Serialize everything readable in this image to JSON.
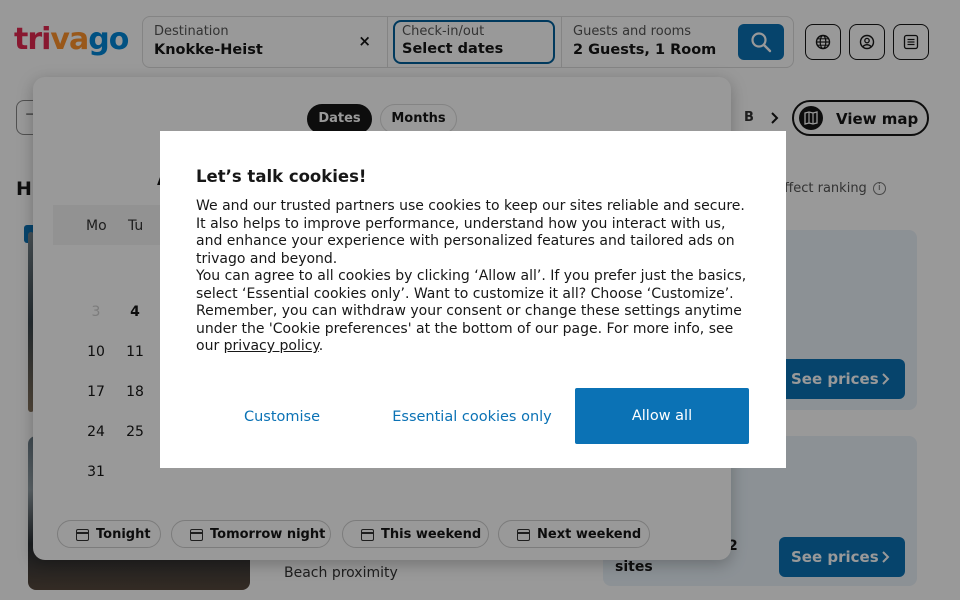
{
  "header": {
    "logo": {
      "part1": "tri",
      "part2": "va",
      "part3": "go"
    },
    "destination": {
      "label": "Destination",
      "value": "Knokke-Heist",
      "clear_icon": "×"
    },
    "dates": {
      "label": "Check-in/out",
      "value": "Select dates"
    },
    "guests": {
      "label": "Guests and rooms",
      "value": "2 Guests, 1 Room"
    },
    "icons": [
      "search-icon",
      "globe-icon",
      "user-icon",
      "menu-icon"
    ]
  },
  "results": {
    "heading_partial": "H",
    "ranking_note": "to us affect ranking",
    "info_icon": "i",
    "filter_partial": "B",
    "map_button": "View map",
    "see_prices": "See prices",
    "card2_two": "2",
    "card2_sites": "sites",
    "card2_feature": "Beach proximity",
    "filter_edge": "⊣"
  },
  "calendar": {
    "toggle": {
      "dates": "Dates",
      "months": "Months",
      "active": "Dates"
    },
    "month_partial": "A",
    "weekdays": [
      "Mo",
      "Tu"
    ],
    "days": {
      "r1": [
        "3",
        "4"
      ],
      "r2": [
        "10",
        "11"
      ],
      "r3": [
        "17",
        "18"
      ],
      "r4": [
        "24",
        "25"
      ],
      "r5": [
        "31"
      ]
    },
    "quick": [
      "Tonight",
      "Tomorrow night",
      "This weekend",
      "Next weekend"
    ]
  },
  "cookie_dialog": {
    "title": "Let’s talk cookies!",
    "p1": "We and our trusted partners use cookies to keep our sites reliable and secure. It also helps to improve performance, understand how you interact with us, and enhance your experience with personalized features and tailored ads on trivago and beyond.",
    "p2_pre": "You can agree to all cookies by clicking ‘Allow all’. If you prefer just the basics, select ‘Essential cookies only’. Want to customize it all? Choose ‘Customize’. Remember, you can withdraw your consent or change these settings anytime under the 'Cookie preferences' at the bottom of our page. For more info, see our ",
    "p2_link": "privacy policy",
    "p2_post": ".",
    "customise": "Customise",
    "essential": "Essential cookies only",
    "allow_all": "Allow all"
  },
  "colors": {
    "accent": "#0b72b5",
    "logo_red": "#e32851",
    "logo_orange": "#ff932c",
    "logo_blue": "#0088d9"
  }
}
